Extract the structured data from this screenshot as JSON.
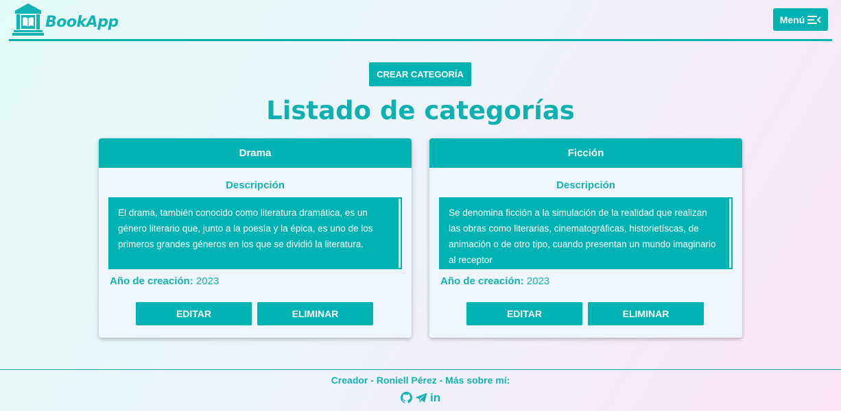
{
  "header": {
    "logo_text": "BookApp",
    "menu_label": "Menú",
    "menu_icon": "menu-icon"
  },
  "main": {
    "create_label": "CREAR CATEGORÍA",
    "title": "Listado de categorías"
  },
  "categories": [
    {
      "name": "Drama",
      "description_label": "Descripción",
      "description": "El drama, también conocido como literatura dramática, es un género literario que, junto a la poesía y la épica, es uno de los primeros grandes géneros en los que se dividió la literatura.",
      "year_label": "Año de creación:",
      "year": "2023",
      "edit_label": "EDITAR",
      "delete_label": "ELIMINAR"
    },
    {
      "name": "Ficción",
      "description_label": "Descripción",
      "description": "Se denomina ficción a la simulación de la realidad que realizan las obras como literarias, cinematográficas, historietíscas, de animación o de otro tipo, cuando presentan un mundo imaginario al receptor",
      "year_label": "Año de creación:",
      "year": "2023",
      "edit_label": "EDITAR",
      "delete_label": "ELIMINAR"
    }
  ],
  "footer": {
    "text": "Creador - Roniell Pérez - Más sobre mí:",
    "icons": [
      "github-icon",
      "telegram-icon",
      "linkedin-icon"
    ],
    "linkedin_text": "in"
  },
  "colors": {
    "accent": "#00b3b3",
    "card_bg": "#eef5fd"
  }
}
